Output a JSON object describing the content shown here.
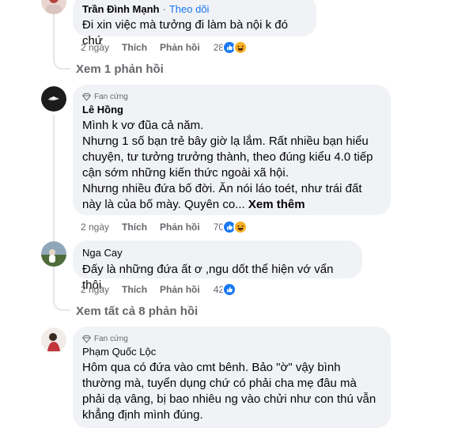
{
  "comments": [
    {
      "author": "Trần Đình Mạnh",
      "follow": "Theo dõi",
      "text": [
        "Đi xin việc mà tưởng đi làm bà nội k đó chứ"
      ],
      "time": "2 ngày",
      "like": "Thích",
      "reply": "Phản hồi",
      "reactions": "28",
      "reaction_icons": [
        "like-icon",
        "haha-icon"
      ]
    },
    {
      "badge": "Fan cứng",
      "author": "Lê Hồng",
      "text": [
        "Mình k vơ đũa cả năm.",
        "Nhưng 1 số bạn trẻ bây giờ lạ lắm. Rất nhiều bạn hiểu chuyện, tư tưởng trưởng thành, theo đúng kiểu 4.0 tiếp cận sớm những kiến thức ngoài xã hội.",
        "Nhưng nhiều đứa bố đời. Ăn nói láo toét, như trái đất này là của bố mày. Quyên co..."
      ],
      "see_more": "Xem thêm",
      "time": "2 ngày",
      "like": "Thích",
      "reply": "Phản hồi",
      "reactions": "70",
      "reaction_icons": [
        "like-icon",
        "haha-icon"
      ]
    },
    {
      "author": "Nga Cay",
      "text": [
        "Đấy là những đứa ất ơ ,ngu dốt thể hiện vớ vẩn thôi."
      ],
      "time": "2 ngày",
      "like": "Thích",
      "reply": "Phản hồi",
      "reactions": "42",
      "reaction_icons": [
        "like-icon"
      ]
    },
    {
      "badge": "Fan cứng",
      "author": "Phạm Quốc Lộc",
      "text": [
        "Hôm qua có đứa vào cmt bênh. Bảo \"ờ\" vậy bình thường mà, tuyển dụng chứ có phải cha mẹ đâu mà phải dạ vâng, bị bao nhiêu ng vào chửi như con thú vẫn khẳng định mình đúng."
      ]
    }
  ],
  "view_replies_1": "Xem 1 phản hồi",
  "view_replies_2": "Xem tất cả 8 phản hồi",
  "colors": {
    "bubble": "#f0f2f5",
    "link": "#1877f2",
    "secondary": "#65676b",
    "like": "#1877f2",
    "haha": "#f7b125"
  }
}
